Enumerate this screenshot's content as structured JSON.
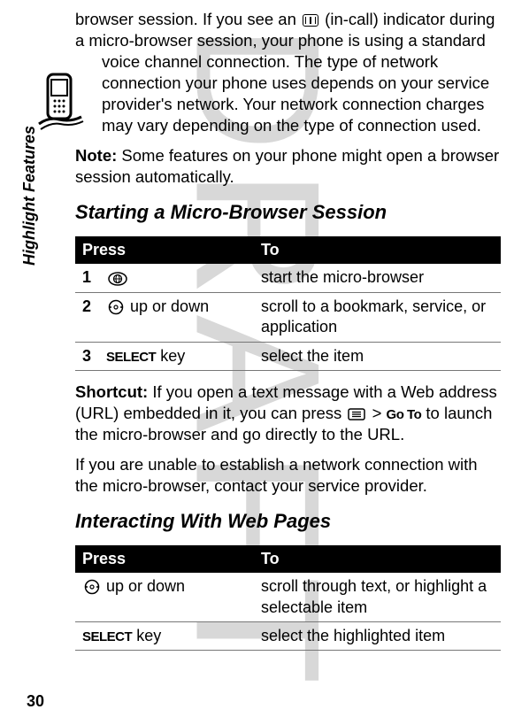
{
  "watermark": "DRAFT",
  "sidebar_label": "Highlight Features",
  "intro": {
    "line1": "browser session. If you see an ",
    "line2": " (in-call) indicator during a micro-browser session, your phone is using a standard ",
    "line3": "voice channel connection. The type of network connection your phone uses depends on your service provider's network. Your network connection charges may vary depending on the type of connection used."
  },
  "note": {
    "label": "Note:",
    "text": " Some features on your phone might open a browser session automatically."
  },
  "heading1": "Starting a Micro-Browser Session",
  "table1": {
    "headers": {
      "press": "Press",
      "to": "To"
    },
    "rows": [
      {
        "num": "1",
        "press_icon": "globe",
        "press_text": "",
        "to": "start the micro-browser"
      },
      {
        "num": "2",
        "press_icon": "nav",
        "press_text": " up or down",
        "to": "scroll to a bookmark, service, or application"
      },
      {
        "num": "3",
        "press_caps": "SELECT",
        "press_text": " key",
        "to": "select the item"
      }
    ]
  },
  "shortcut": {
    "label": "Shortcut:",
    "text1": " If you open a text message with a Web address (URL) embedded in it, you can press ",
    "goto": "Go To",
    "text2": " to launch the micro-browser and go directly to the URL."
  },
  "para2": "If you are unable to establish a network connection with the micro-browser, contact your service provider.",
  "heading2": "Interacting With Web Pages",
  "table2": {
    "headers": {
      "press": "Press",
      "to": "To"
    },
    "rows": [
      {
        "press_icon": "nav",
        "press_text": " up or down",
        "to": "scroll through text, or highlight a selectable item"
      },
      {
        "press_caps": "SELECT",
        "press_text": " key",
        "to": "select the highlighted item"
      }
    ]
  },
  "page_number": "30"
}
